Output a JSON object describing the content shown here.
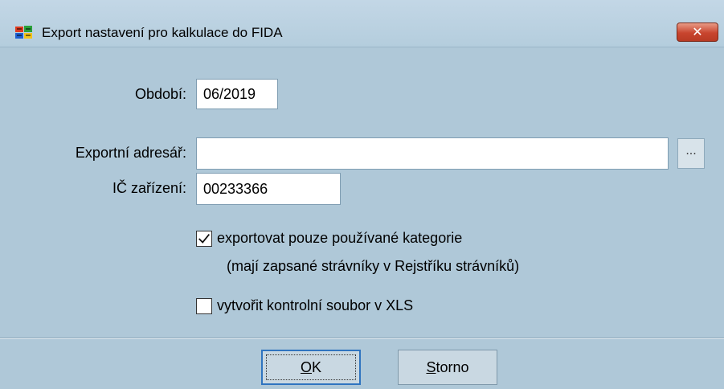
{
  "window": {
    "title": "Export nastavení pro kalkulace do FIDA",
    "close_label": "x"
  },
  "form": {
    "obdobi_label": "Období:",
    "obdobi_value": "06/2019",
    "adresar_label": "Exportní adresář:",
    "adresar_value": "",
    "browse_label": "...",
    "ic_label": "IČ zařízení:",
    "ic_value": "00233366"
  },
  "options": {
    "only_used": {
      "checked": true,
      "label": "exportovat pouze používané kategorie",
      "note": "(mají zapsané strávníky v Rejstříku strávníků)"
    },
    "xls": {
      "checked": false,
      "label": "vytvořit kontrolní soubor v XLS"
    }
  },
  "buttons": {
    "ok_mnemonic": "O",
    "ok_rest": "K",
    "storno_mnemonic": "S",
    "storno_rest": "torno"
  }
}
